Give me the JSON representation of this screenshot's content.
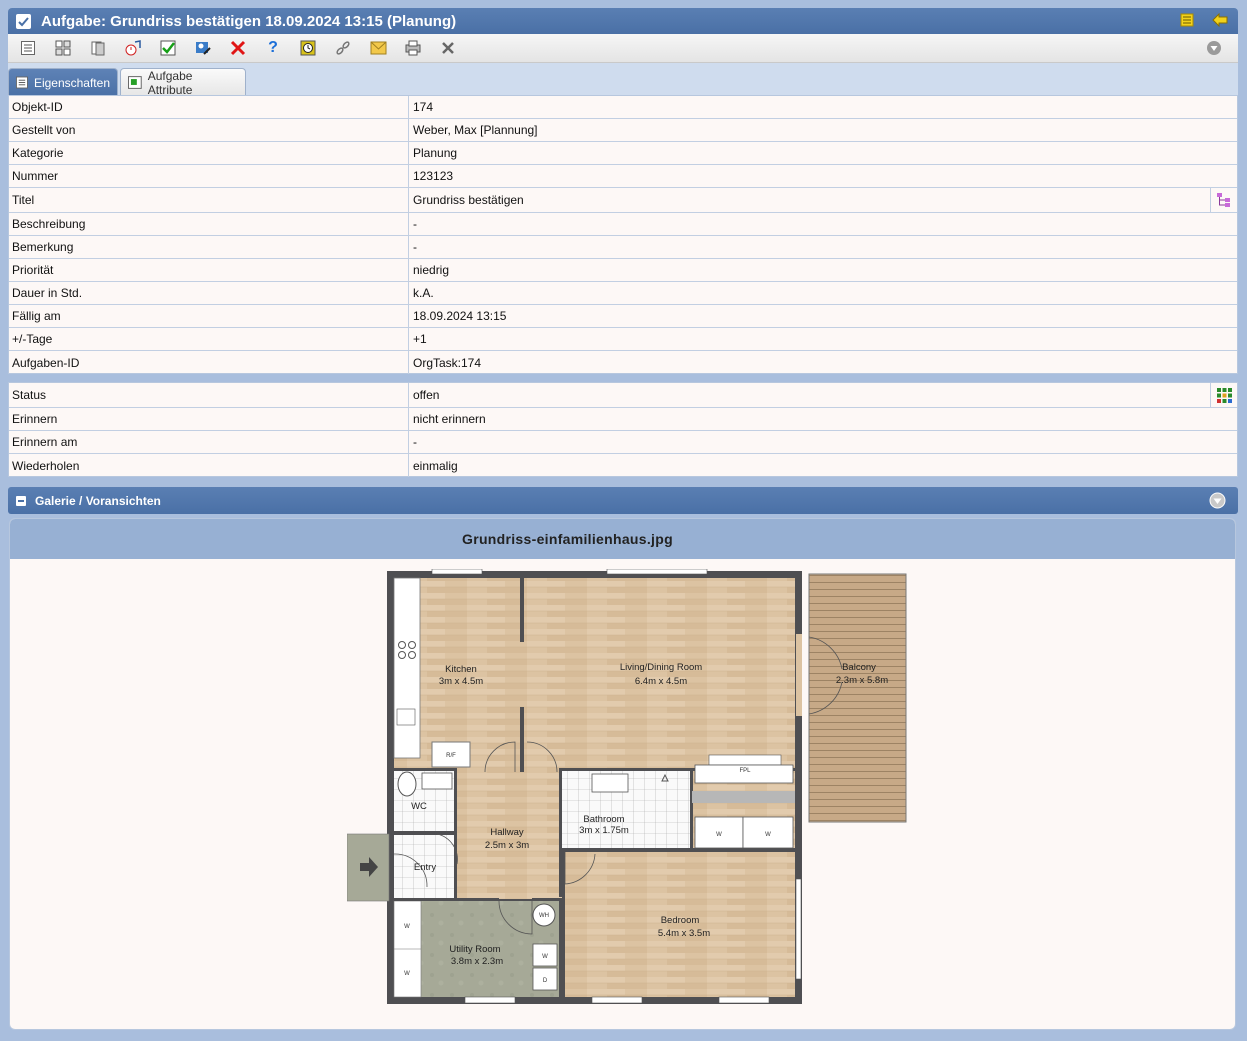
{
  "window": {
    "title": "Aufgabe: Grundriss bestätigen 18.09.2024 13:15 (Planung)"
  },
  "tabs": [
    {
      "label": "Eigenschaften"
    },
    {
      "label": "Aufgabe Attribute"
    }
  ],
  "properties": [
    {
      "label": "Objekt-ID",
      "value": "174"
    },
    {
      "label": "Gestellt von",
      "value": "Weber, Max [Plannung]"
    },
    {
      "label": "Kategorie",
      "value": "Planung"
    },
    {
      "label": "Nummer",
      "value": "123123"
    },
    {
      "label": "Titel",
      "value": "Grundriss bestätigen"
    },
    {
      "label": "Beschreibung",
      "value": "-"
    },
    {
      "label": "Bemerkung",
      "value": "-"
    },
    {
      "label": "Priorität",
      "value": "niedrig"
    },
    {
      "label": "Dauer in Std.",
      "value": "k.A."
    },
    {
      "label": "Fällig am",
      "value": "18.09.2024 13:15"
    },
    {
      "label": "+/-Tage",
      "value": "+1"
    },
    {
      "label": "Aufgaben-ID",
      "value": "OrgTask:174"
    }
  ],
  "status_properties": [
    {
      "label": "Status",
      "value": "offen"
    },
    {
      "label": "Erinnern",
      "value": "nicht erinnern"
    },
    {
      "label": "Erinnern am",
      "value": "-"
    },
    {
      "label": "Wiederholen",
      "value": "einmalig"
    }
  ],
  "gallery": {
    "title": "Galerie / Voransichten",
    "image_name": "Grundriss-einfamilienhaus.jpg"
  },
  "floorplan": {
    "rooms": [
      {
        "name": "Kitchen",
        "size": "3m x 4.5m"
      },
      {
        "name": "Living/Dining Room",
        "size": "6.4m x 4.5m"
      },
      {
        "name": "Balcony",
        "size": "2.3m x 5.8m"
      },
      {
        "name": "Bathroom",
        "size": "3m x 1.75m"
      },
      {
        "name": "Hallway",
        "size": "2.5m x 3m"
      },
      {
        "name": "Bedroom",
        "size": "5.4m x 3.5m"
      },
      {
        "name": "Utility Room",
        "size": "3.8m x 2.3m"
      }
    ],
    "labels": {
      "wc": "WC",
      "entry": "Entry",
      "rf": "R/F",
      "fpl": "FPL",
      "w": "W",
      "wh": "WH",
      "d": "D"
    }
  },
  "colors": {
    "header_blue": "#4e73a9",
    "accent_yellow": "#f2d21b",
    "delete_red": "#e01515"
  },
  "icons": {
    "toolbar": [
      "list-icon",
      "grid-icon",
      "copy-icon",
      "clock-music-icon",
      "check-icon",
      "user-edit-icon",
      "delete-icon",
      "help-icon",
      "timer-icon",
      "link-icon",
      "mail-icon",
      "print-icon",
      "close-icon"
    ]
  }
}
